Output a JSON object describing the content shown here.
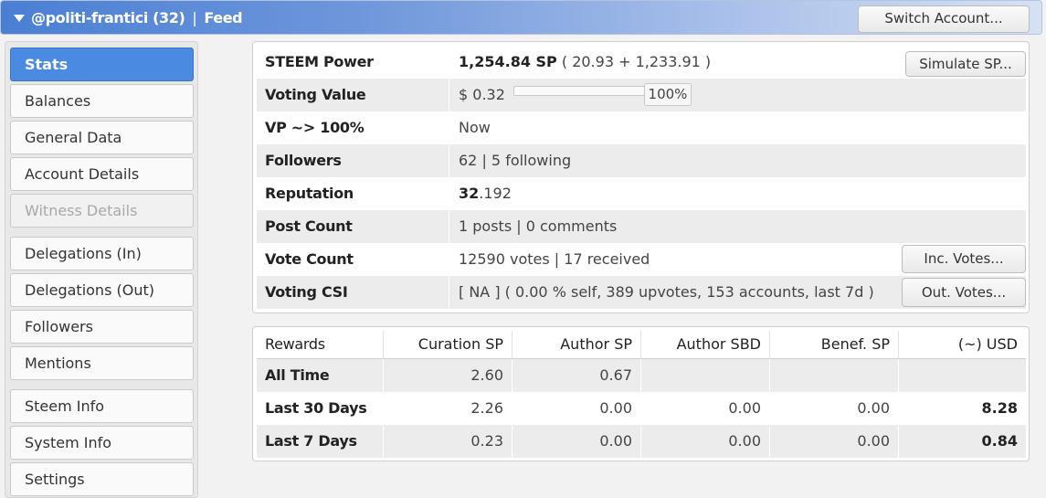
{
  "header": {
    "account": "@politi-frantici (32)",
    "separator": "|",
    "section": "Feed",
    "switch_label": "Switch Account..."
  },
  "sidebar": {
    "items": [
      {
        "label": "Stats"
      },
      {
        "label": "Balances"
      },
      {
        "label": "General Data"
      },
      {
        "label": "Account Details"
      },
      {
        "label": "Witness Details"
      },
      {
        "label": "Delegations (In)"
      },
      {
        "label": "Delegations (Out)"
      },
      {
        "label": "Followers"
      },
      {
        "label": "Mentions"
      },
      {
        "label": "Steem Info"
      },
      {
        "label": "System Info"
      },
      {
        "label": "Settings"
      }
    ]
  },
  "stats": {
    "steem_power": {
      "label": "STEEM Power",
      "value_bold": "1,254.84 SP",
      "value_rest": " ( 20.93 + 1,233.91 )",
      "button": "Simulate SP..."
    },
    "voting_value": {
      "label": "Voting Value",
      "value": "$ 0.32",
      "percent_label": "100%",
      "percent": 100
    },
    "vp": {
      "label": "VP ~> 100%",
      "value": "Now"
    },
    "followers": {
      "label": "Followers",
      "value": "62 | 5 following"
    },
    "reputation": {
      "label": "Reputation",
      "value_bold": "32",
      "value_rest": ".192"
    },
    "post_count": {
      "label": "Post Count",
      "value": "1 posts | 0 comments"
    },
    "vote_count": {
      "label": "Vote Count",
      "value": "12590 votes | 17 received",
      "button": "Inc. Votes..."
    },
    "voting_csi": {
      "label": "Voting CSI",
      "value": "[ NA ] ( 0.00 % self, 389 upvotes, 153 accounts, last 7d )",
      "button": "Out. Votes..."
    }
  },
  "rewards": {
    "headers": [
      "Rewards",
      "Curation SP",
      "Author SP",
      "Author SBD",
      "Benef. SP",
      "(~) USD"
    ],
    "rows": [
      {
        "label": "All Time",
        "values": [
          "2.60",
          "0.67",
          "",
          "",
          ""
        ]
      },
      {
        "label": "Last 30 Days",
        "values": [
          "2.26",
          "0.00",
          "0.00",
          "0.00",
          "8.28"
        ]
      },
      {
        "label": "Last 7 Days",
        "values": [
          "0.23",
          "0.00",
          "0.00",
          "0.00",
          "0.84"
        ]
      }
    ]
  },
  "colors": {
    "accent": "#4a8ae0",
    "header_gradient_start": "#4a7fd4",
    "row_shade": "#ececec"
  }
}
